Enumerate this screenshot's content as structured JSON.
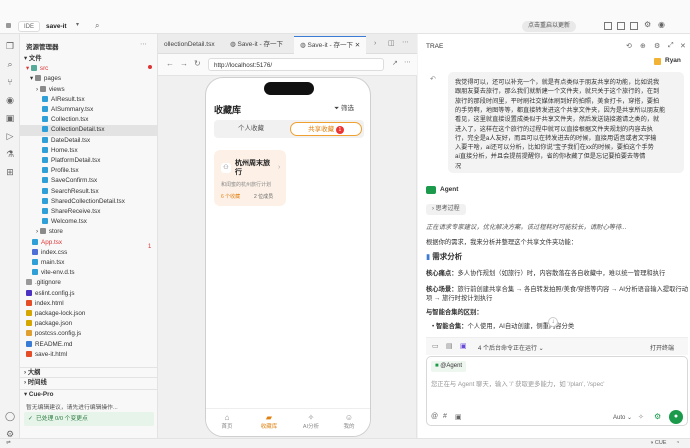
{
  "titlebar": {
    "ide": "IDE",
    "project": "save-it",
    "notice": "点击重启以更新"
  },
  "sidebar": {
    "title": "资源管理器",
    "files_section": "文件",
    "src": "src",
    "items": [
      {
        "label": "pages",
        "color": "#8a8a8a"
      },
      {
        "label": "views",
        "color": "#8a8a8a"
      },
      {
        "label": "AIResult.tsx",
        "color": "#2f9fd8"
      },
      {
        "label": "AISummary.tsx",
        "color": "#2f9fd8"
      },
      {
        "label": "Collection.tsx",
        "color": "#2f9fd8"
      },
      {
        "label": "CollectionDetail.tsx",
        "color": "#2f9fd8"
      },
      {
        "label": "DateDetail.tsx",
        "color": "#2f9fd8"
      },
      {
        "label": "Home.tsx",
        "color": "#2f9fd8"
      },
      {
        "label": "PlatformDetail.tsx",
        "color": "#2f9fd8"
      },
      {
        "label": "Profile.tsx",
        "color": "#2f9fd8"
      },
      {
        "label": "SaveConfirm.tsx",
        "color": "#2f9fd8"
      },
      {
        "label": "SearchResult.tsx",
        "color": "#2f9fd8"
      },
      {
        "label": "SharedCollectionDetail.tsx",
        "color": "#2f9fd8"
      },
      {
        "label": "ShareReceive.tsx",
        "color": "#2f9fd8"
      },
      {
        "label": "Welcome.tsx",
        "color": "#2f9fd8"
      },
      {
        "label": "store",
        "color": "#8a8a8a"
      },
      {
        "label": "App.tsx",
        "color": "#2f9fd8"
      },
      {
        "label": "index.css",
        "color": "#4f6fd8"
      },
      {
        "label": "main.tsx",
        "color": "#2f9fd8"
      },
      {
        "label": "vite-env.d.ts",
        "color": "#2f9fd8"
      },
      {
        "label": ".gitignore",
        "color": "#999999"
      },
      {
        "label": "eslint.config.js",
        "color": "#4b32c3"
      },
      {
        "label": "index.html",
        "color": "#e44d26"
      },
      {
        "label": "package-lock.json",
        "color": "#d6a600"
      },
      {
        "label": "package.json",
        "color": "#d6a600"
      },
      {
        "label": "postcss.config.js",
        "color": "#e0a030"
      },
      {
        "label": "README.md",
        "color": "#3a7bd5"
      },
      {
        "label": "save-it.html",
        "color": "#e44d26"
      }
    ],
    "app_badge": "1",
    "outline": "大纲",
    "timeline": "时间线",
    "cue_title": "Cue-Pro",
    "cue_desc": "暂无编辑建议，请先进行编辑操作...",
    "status": "已处理 0/0 个变更点"
  },
  "editor": {
    "tabs": [
      "ollectionDetail.tsx",
      "Save-it - 存一下",
      "Save-it - 存一下"
    ],
    "url": "http://localhost:5176/"
  },
  "phone": {
    "title": "收藏库",
    "filter": "筛选",
    "seg_personal": "个人收藏",
    "seg_shared": "共享收藏",
    "shared_badge": "1",
    "card_title": "杭州周末旅行",
    "card_sub": "和闺蜜的杭州旅行计划",
    "card_count": "6 个收藏",
    "card_members": "2 位成员",
    "nav": [
      "首页",
      "收藏库",
      "AI分析",
      "我的"
    ]
  },
  "chat": {
    "header": "TRAE",
    "user": "Ryan",
    "user_msg": [
      "我觉得可以，还可以补充一个，就是有点类似于朋友共享的功能，比如说我",
      "跟朋友要去旅行，那么我们就新建一个文件夹，就只关于这个旅行的，在到",
      "旅行的那段时间里，平时刷社交媒体刷到好的拍照，美食打卡，穿搭，要拍",
      "的手势啊，地图等等，都直接转发进这个共享文件夹，因为是共享所以朋友能",
      "看见，这里就直接设置成类似于共享文件夹，然后发送链接邀请之类的，就",
      "进入了，这样在这个旅行的过程中就可以直接根据文件夹规划的内容去执",
      "行，完全是a人友好，而且可以在转发进去的时候，直接用语音或者文字输",
      "入要干啥，ai还可以分析，比如你说\"宝子我们在xx的时候，要拍这个手势",
      "ai直接分析，并且会提前提醒你，省的你收藏了但是忘记要拍要去等情",
      "况"
    ],
    "agent": "Agent",
    "thinking": "思考过程",
    "italic": "正在请求专家建议，优化解决方案。该过程耗时可能较长，请耐心等待...",
    "line1": "根据你的需求，我来分析并整理这个共享文件夹功能：",
    "h1": "需求分析",
    "p1_label": "核心痛点：",
    "p1_text": "多人协作规划（如旅行）时，内容散落在各自收藏中，难以统一管理和执行",
    "p2_label": "核心场景：",
    "p2_text1": "旅行前创建共享合集 → 各自转发拍照/美食/穿搭等内容 → AI分析语音输入提取行动",
    "p2_text2": "项 → 旅行时按计划执行",
    "p3": "与智能合集的区别：",
    "bullet_label": "智能合集：",
    "bullet_text": "个人使用，AI自动创建，侧重内容分类",
    "running": "4 个后台命令正在运行",
    "open_term": "打开终端",
    "mention": "@Agent",
    "placeholder": "您正在与 Agent 聊天，输入 '/' 获取更多能力，如 '/plan', '/spec'",
    "auto": "Auto"
  },
  "statusbar": {
    "right": "CUE"
  }
}
